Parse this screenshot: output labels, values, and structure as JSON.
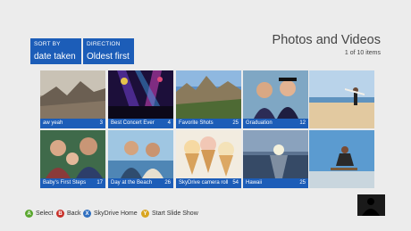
{
  "sort": {
    "label": "SORT BY",
    "value": "date taken"
  },
  "direction": {
    "label": "DIRECTION",
    "value": "Oldest first"
  },
  "header": {
    "title": "Photos and Videos",
    "count": "1 of 10 items"
  },
  "albums": [
    {
      "name": "aw yeah",
      "count": "3"
    },
    {
      "name": "Best Concert Ever",
      "count": "4"
    },
    {
      "name": "Favorite Shots",
      "count": "25"
    },
    {
      "name": "Graduation",
      "count": "12"
    },
    {
      "name": "",
      "count": ""
    },
    {
      "name": "Baby's First Steps",
      "count": "17"
    },
    {
      "name": "Day at the Beach",
      "count": "26"
    },
    {
      "name": "SkyDrive camera roll",
      "count": "54"
    },
    {
      "name": "Hawaii",
      "count": "25"
    },
    {
      "name": "",
      "count": ""
    }
  ],
  "controls": [
    {
      "key": "A",
      "label": "Select",
      "color": "#5aa72f"
    },
    {
      "key": "B",
      "label": "Back",
      "color": "#c8312a"
    },
    {
      "key": "X",
      "label": "SkyDrive Home",
      "color": "#2f6fc0"
    },
    {
      "key": "Y",
      "label": "Start Slide Show",
      "color": "#d9a520"
    }
  ]
}
